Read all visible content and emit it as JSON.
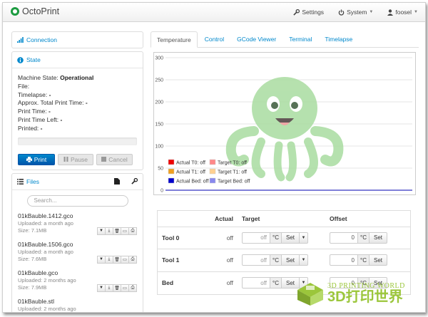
{
  "navbar": {
    "brand": "OctoPrint",
    "settings": "Settings",
    "system": "System",
    "user": "foosel"
  },
  "connection": {
    "title": "Connection"
  },
  "state": {
    "title": "State",
    "machine_state_label": "Machine State:",
    "machine_state_value": "Operational",
    "file_label": "File:",
    "timelapse_label": "Timelapse:",
    "timelapse_value": "-",
    "approx_label": "Approx. Total Print Time:",
    "approx_value": "-",
    "print_time_label": "Print Time:",
    "print_time_value": "-",
    "time_left_label": "Print Time Left:",
    "time_left_value": "-",
    "printed_label": "Printed:",
    "printed_value": "-",
    "print_btn": "Print",
    "pause_btn": "Pause",
    "cancel_btn": "Cancel"
  },
  "files": {
    "title": "Files",
    "search_placeholder": "Search...",
    "items": [
      {
        "name": "01kBauble.1412.gco",
        "uploaded": "Uploaded: a month ago",
        "size": "Size: 7.1MB"
      },
      {
        "name": "01kBauble.1506.gco",
        "uploaded": "Uploaded: a month ago",
        "size": "Size: 7.6MB"
      },
      {
        "name": "01kBauble.gco",
        "uploaded": "Uploaded: 2 months ago",
        "size": "Size: 7.9MB"
      },
      {
        "name": "01kBauble.stl",
        "uploaded": "Uploaded: 2 months ago",
        "size": ""
      }
    ]
  },
  "tabs": [
    "Temperature",
    "Control",
    "GCode Viewer",
    "Terminal",
    "Timelapse"
  ],
  "chart_data": {
    "type": "line",
    "y_ticks": [
      0,
      50,
      100,
      150,
      200,
      250,
      300
    ],
    "ylim": [
      0,
      300
    ],
    "grid": true,
    "legend_position": "bottom-left",
    "series": [
      {
        "name": "Actual T0: off",
        "color": "#ee0000",
        "values": []
      },
      {
        "name": "Target T0: off",
        "color": "#ff8888",
        "values": []
      },
      {
        "name": "Actual T1: off",
        "color": "#f0a020",
        "values": []
      },
      {
        "name": "Target T1: off",
        "color": "#ffd090",
        "values": []
      },
      {
        "name": "Actual Bed: off",
        "color": "#0000cc",
        "values": []
      },
      {
        "name": "Target Bed: off",
        "color": "#8888ee",
        "values": []
      }
    ]
  },
  "temps": {
    "headers": {
      "actual": "Actual",
      "target": "Target",
      "offset": "Offset"
    },
    "unit": "°C",
    "set_label": "Set",
    "rows": [
      {
        "label": "Tool 0",
        "actual": "off",
        "target_placeholder": "off",
        "offset": "0"
      },
      {
        "label": "Tool 1",
        "actual": "off",
        "target_placeholder": "off",
        "offset": "0"
      },
      {
        "label": "Bed",
        "actual": "off",
        "target_placeholder": "off",
        "offset": "0"
      }
    ]
  },
  "watermark": {
    "line1": "3D PRINTING WORLD",
    "line2": "3D打印世界"
  },
  "colors": {
    "accent": "#0088cc",
    "octopus": "#7fc97a",
    "watermark": "#9bc63b"
  }
}
